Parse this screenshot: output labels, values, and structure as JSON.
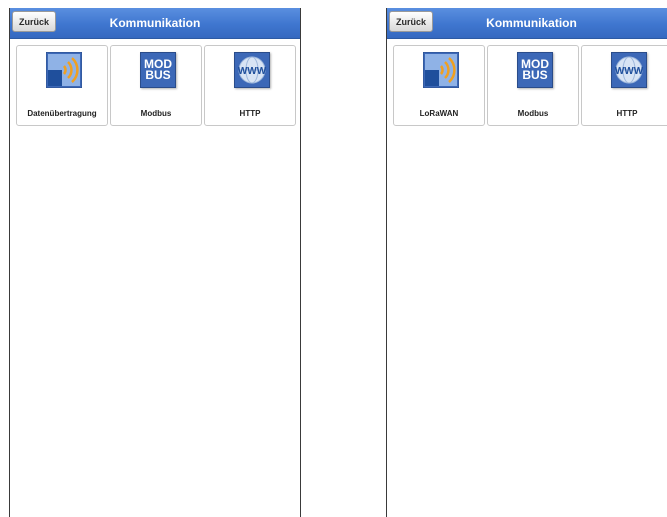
{
  "screens": [
    {
      "back_label": "Zurück",
      "title": "Kommunikation",
      "tiles": [
        {
          "label": "Datenübertragung",
          "icon": "data-transmission-icon"
        },
        {
          "label": "Modbus",
          "icon": "modbus-icon",
          "icon_text_top": "MOD",
          "icon_text_bottom": "BUS"
        },
        {
          "label": "HTTP",
          "icon": "www-icon",
          "icon_text": "WWW"
        }
      ]
    },
    {
      "back_label": "Zurück",
      "title": "Kommunikation",
      "tiles": [
        {
          "label": "LoRaWAN",
          "icon": "data-transmission-icon"
        },
        {
          "label": "Modbus",
          "icon": "modbus-icon",
          "icon_text_top": "MOD",
          "icon_text_bottom": "BUS"
        },
        {
          "label": "HTTP",
          "icon": "www-icon",
          "icon_text": "WWW"
        }
      ]
    }
  ],
  "colors": {
    "header": "#4a80d8",
    "icon_blue": "#3c68b7",
    "signal_orange": "#f0a020"
  }
}
